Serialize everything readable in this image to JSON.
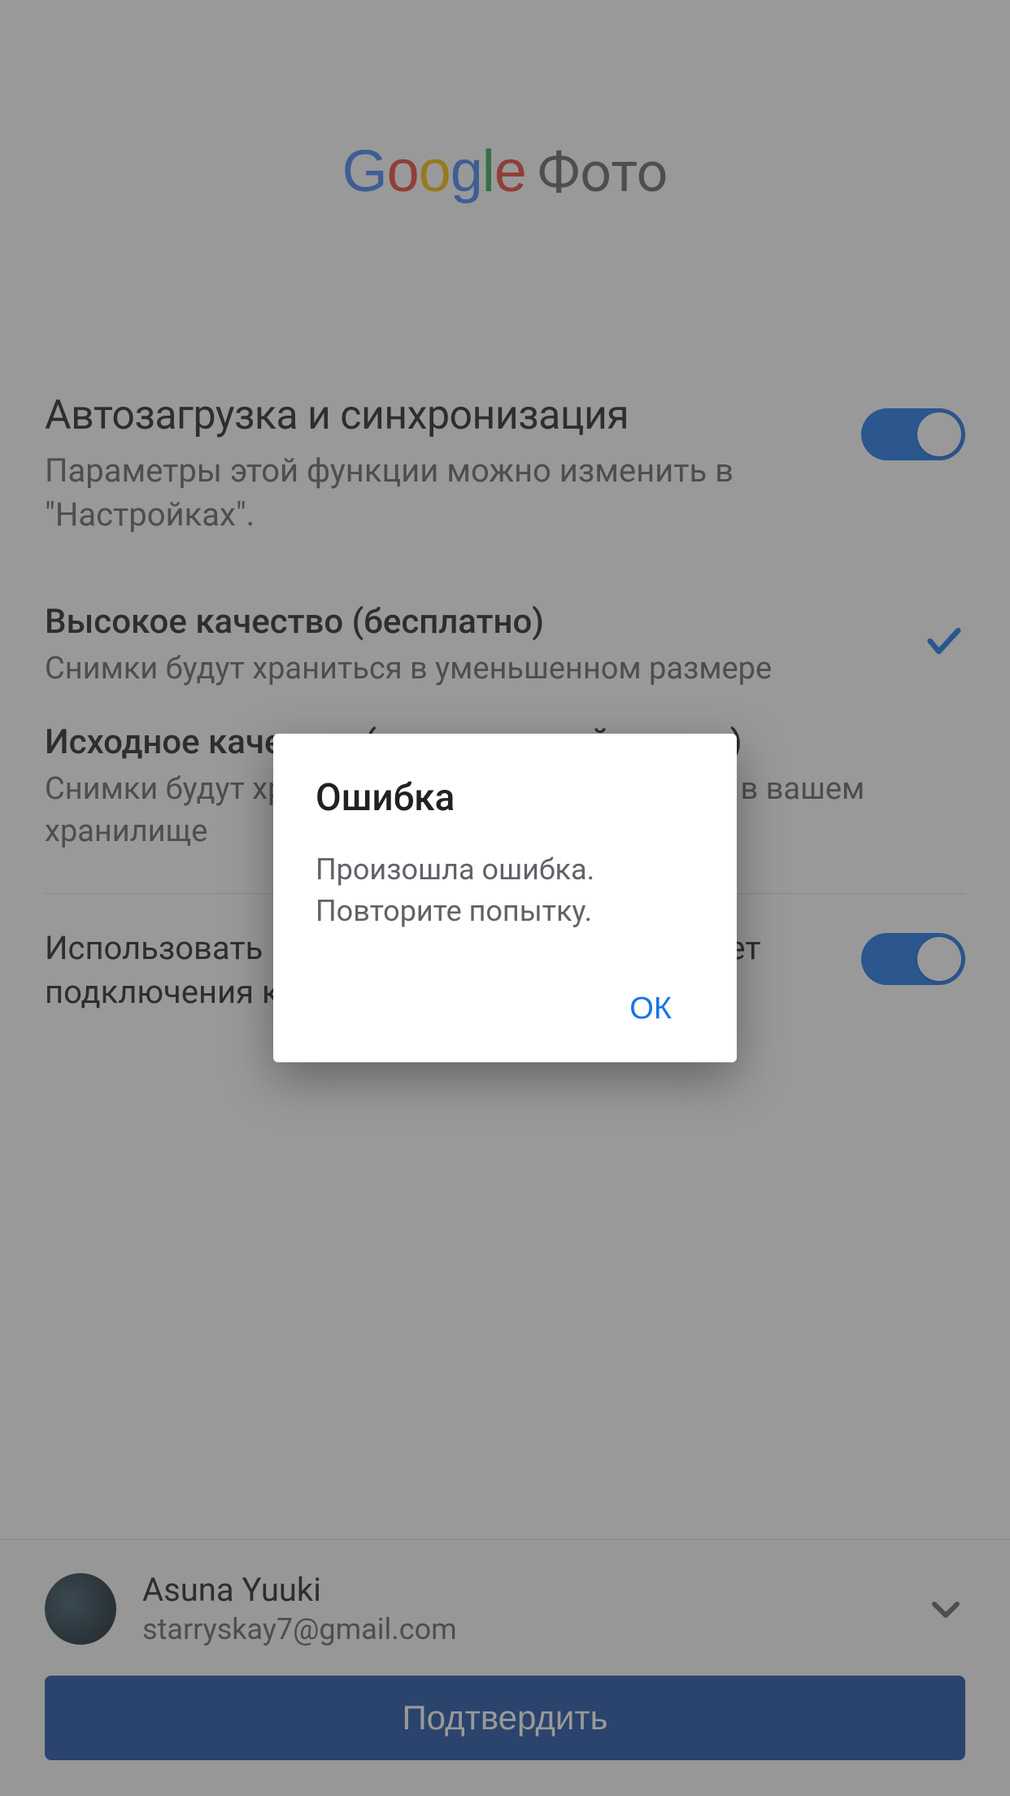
{
  "logo": {
    "google": "Google",
    "product": "Фото"
  },
  "backup": {
    "title": "Автозагрузка и синхронизация",
    "subtitle": "Параметры этой функции можно изменить в \"Настройках\"."
  },
  "quality_high": {
    "title": "Высокое качество (бесплатно)",
    "subtitle": "Снимки будут храниться в уменьшенном размере"
  },
  "quality_original": {
    "title": "Исходное качество (ограниченный доступ)",
    "subtitle": "Снимки будут храниться в полном разрешении в вашем хранилище"
  },
  "mobile_data": {
    "label": "Использовать мобильный Интернет, когда нет подключения к сети Wi-Fi"
  },
  "account": {
    "name": "Asuna Yuuki",
    "email": "starryskay7@gmail.com"
  },
  "confirm_button": "Подтвердить",
  "dialog": {
    "title": "Ошибка",
    "body": "Произошла ошибка.\nПовторите попытку.",
    "ok": "ОК"
  }
}
